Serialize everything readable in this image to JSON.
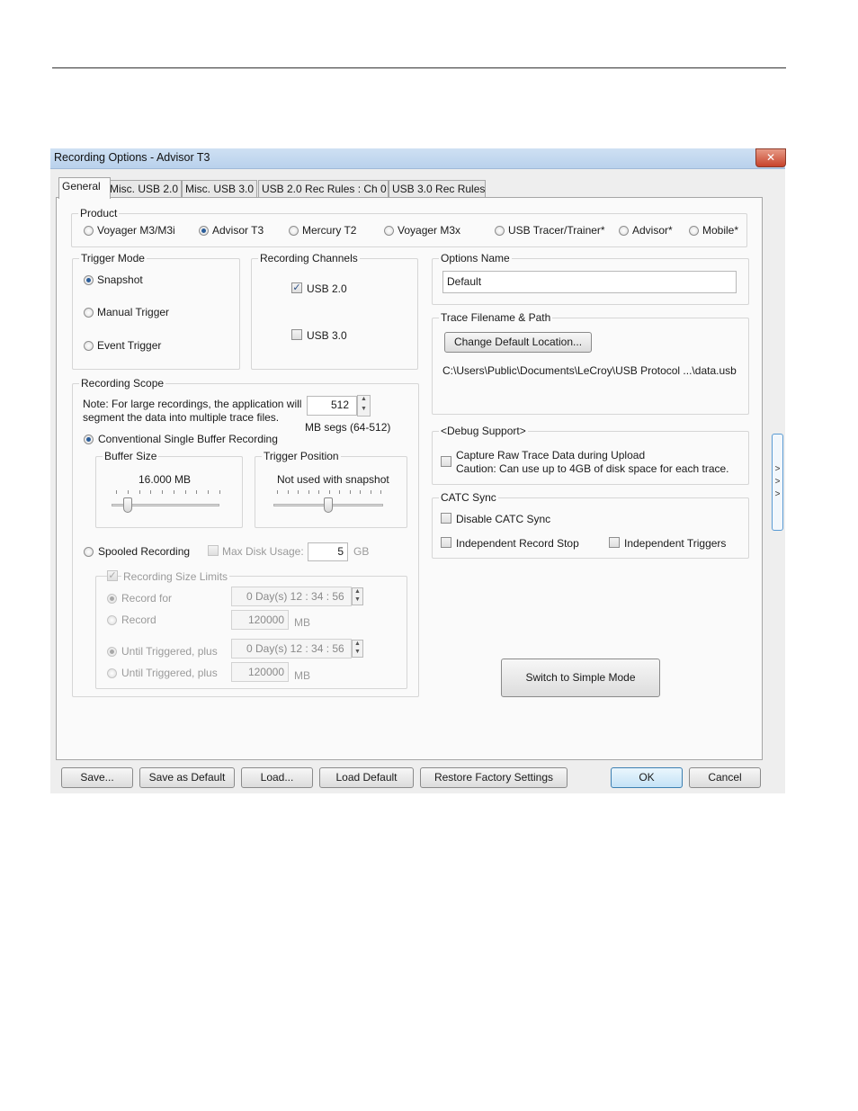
{
  "window": {
    "title": "Recording Options - Advisor T3",
    "close": "✕"
  },
  "tabs": [
    "General",
    "Misc. USB 2.0",
    "Misc. USB 3.0",
    "USB 2.0 Rec Rules : Ch 0",
    "USB 3.0 Rec Rules"
  ],
  "product": {
    "label": "Product",
    "options": [
      "Voyager M3/M3i",
      "Advisor T3",
      "Mercury T2",
      "Voyager M3x",
      "USB Tracer/Trainer*",
      "Advisor*",
      "Mobile*"
    ],
    "selected": "Advisor T3"
  },
  "trigger_mode": {
    "label": "Trigger Mode",
    "options": [
      "Snapshot",
      "Manual Trigger",
      "Event Trigger"
    ],
    "selected": "Snapshot"
  },
  "recording_channels": {
    "label": "Recording Channels",
    "usb2": "USB 2.0",
    "usb2_checked": true,
    "usb3": "USB 3.0",
    "usb3_checked": false
  },
  "options_name": {
    "label": "Options Name",
    "value": "Default"
  },
  "trace_path": {
    "label": "Trace Filename & Path",
    "button": "Change Default Location...",
    "path": "C:\\Users\\Public\\Documents\\LeCroy\\USB Protocol ...\\data.usb"
  },
  "recording_scope": {
    "label": "Recording Scope",
    "note_line1": "Note: For large recordings, the application will",
    "note_line2": "segment the data into multiple trace files.",
    "segs_value": "512",
    "segs_unit": "MB segs (64-512)",
    "conventional": "Conventional Single Buffer Recording",
    "buffer_size_label": "Buffer Size",
    "buffer_size_value": "16.000 MB",
    "buffer_slider_fraction": 0.15,
    "trigger_position_label": "Trigger Position",
    "trigger_position_note": "Not used with snapshot",
    "trigger_slider_fraction": 0.5,
    "spooled": "Spooled Recording",
    "max_disk_label": "Max Disk Usage:",
    "max_disk_value": "5",
    "max_disk_unit": "GB",
    "size_limits_label": "Recording Size Limits",
    "record_for": "Record for",
    "record_for_value": "0 Day(s)  12 : 34 : 56",
    "record": "Record",
    "record_value": "120000",
    "record_unit": "MB",
    "until_triggered_1": "Until Triggered, plus",
    "until_triggered_1_value": "0 Day(s)  12 : 34 : 56",
    "until_triggered_2": "Until Triggered, plus",
    "until_triggered_2_value": "120000",
    "until_triggered_2_unit": "MB"
  },
  "debug_support": {
    "label": "<Debug Support>",
    "line1": "Capture Raw Trace Data during Upload",
    "line2": "Caution: Can use up to 4GB of disk space for each trace."
  },
  "catc_sync": {
    "label": "CATC Sync",
    "disable": "Disable CATC Sync",
    "record_stop": "Independent Record Stop",
    "triggers": "Independent Triggers"
  },
  "expander": ">\n>\n>",
  "simple_mode_button": "Switch to Simple Mode",
  "footer_buttons": {
    "save": "Save...",
    "save_default": "Save as Default",
    "load": "Load...",
    "load_default": "Load Default",
    "restore": "Restore Factory Settings",
    "ok": "OK",
    "cancel": "Cancel"
  }
}
